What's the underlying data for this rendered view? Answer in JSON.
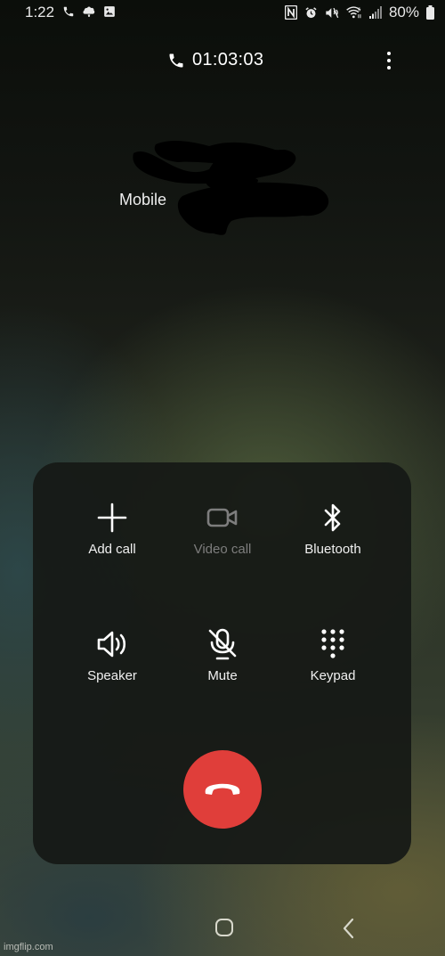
{
  "status_bar": {
    "time": "1:22",
    "left_icons": [
      "phone-call-icon",
      "notification-app-icon",
      "gallery-icon"
    ],
    "right_icons": [
      "nfc-icon",
      "alarm-icon",
      "vibrate-mute-icon",
      "wifi-icon",
      "signal-icon",
      "battery-icon"
    ],
    "battery_percent": "80%"
  },
  "call": {
    "duration": "01:03:03",
    "contact_name": "",
    "contact_label": "Mobile"
  },
  "controls": [
    {
      "id": "add-call",
      "label": "Add call",
      "icon": "plus-icon",
      "enabled": true
    },
    {
      "id": "video-call",
      "label": "Video call",
      "icon": "video-camera-icon",
      "enabled": false
    },
    {
      "id": "bluetooth",
      "label": "Bluetooth",
      "icon": "bluetooth-icon",
      "enabled": true
    },
    {
      "id": "speaker",
      "label": "Speaker",
      "icon": "speaker-icon",
      "enabled": true
    },
    {
      "id": "mute",
      "label": "Mute",
      "icon": "microphone-off-icon",
      "enabled": true
    },
    {
      "id": "keypad",
      "label": "Keypad",
      "icon": "keypad-icon",
      "enabled": true
    }
  ],
  "end_call": {
    "icon": "hang-up-icon",
    "color": "#e03e3a"
  },
  "nav_bar": {
    "home": "home-icon",
    "back": "back-icon"
  },
  "watermark": "imgflip.com"
}
